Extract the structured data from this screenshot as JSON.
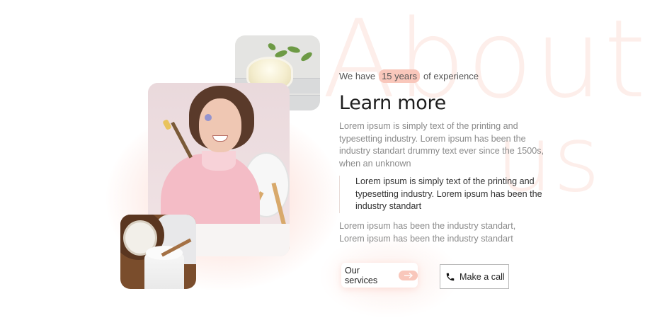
{
  "background": {
    "word_line1": "About",
    "word_line2": "us"
  },
  "images": {
    "cream": "cream-jar-photo",
    "woman": "woman-with-brush-photo",
    "coconut": "coconut-oil-photo"
  },
  "about": {
    "experience_prefix": "We have",
    "experience_value": "15 years",
    "experience_suffix": "of experience",
    "heading": "Learn more",
    "paragraph1": "Lorem ipsum is simply text of the printing and typesetting industry. Lorem ipsum has been the industry standart drummy text ever since the 1500s, when an unknown",
    "quote": "Lorem ipsum is simply text of the printing and typesetting industry. Lorem ipsum has been the industry standart",
    "paragraph2": "Lorem ipsum has been the industry standart, Lorem ipsum has been the industry standart"
  },
  "buttons": {
    "services_label": "Our services",
    "services_icon": "arrow-right-icon",
    "call_label": "Make a call",
    "call_icon": "phone-icon"
  },
  "colors": {
    "accent": "#f9c7bb",
    "background_word": "#fdeeea",
    "heading": "#1e1e1e",
    "muted_text": "#8a8a8a"
  }
}
